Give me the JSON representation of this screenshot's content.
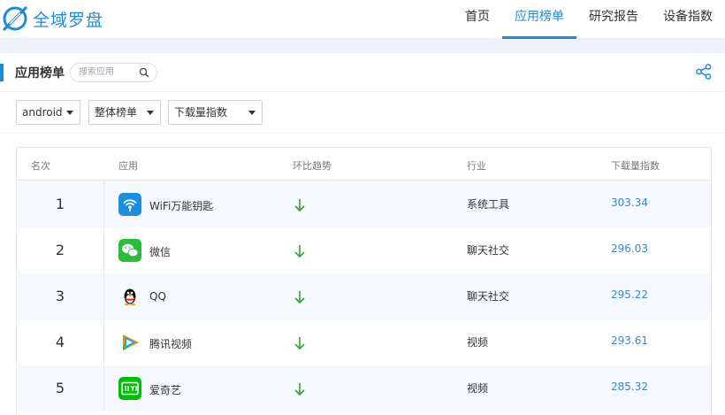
{
  "header": {
    "logo_text": "全域罗盘",
    "nav": [
      {
        "label": "首页",
        "active": false
      },
      {
        "label": "应用榜单",
        "active": true
      },
      {
        "label": "研究报告",
        "active": false
      },
      {
        "label": "设备指数",
        "active": false
      }
    ]
  },
  "card": {
    "title": "应用榜单",
    "search_placeholder": "搜索应用"
  },
  "filters": {
    "platform": "android",
    "chart_type": "整体榜单",
    "metric": "下载量指数"
  },
  "table": {
    "columns": [
      "名次",
      "应用",
      "环比趋势",
      "行业",
      "下载量指数"
    ],
    "rows": [
      {
        "rank": "1",
        "app": "WiFi万能钥匙",
        "icon": "wifi-key-icon",
        "trend": "down",
        "industry": "系统工具",
        "index": "303.34"
      },
      {
        "rank": "2",
        "app": "微信",
        "icon": "wechat-icon",
        "trend": "down",
        "industry": "聊天社交",
        "index": "296.03"
      },
      {
        "rank": "3",
        "app": "QQ",
        "icon": "qq-penguin-icon",
        "trend": "down",
        "industry": "聊天社交",
        "index": "295.22"
      },
      {
        "rank": "4",
        "app": "腾讯视频",
        "icon": "tencent-video-icon",
        "trend": "down",
        "industry": "视频",
        "index": "293.61"
      },
      {
        "rank": "5",
        "app": "爱奇艺",
        "icon": "iqiyi-icon",
        "trend": "down",
        "industry": "视频",
        "index": "285.32"
      }
    ]
  },
  "colors": {
    "brand": "#1f8bd6",
    "trend_down": "#2fa82f",
    "index_link": "#3a87c7"
  }
}
